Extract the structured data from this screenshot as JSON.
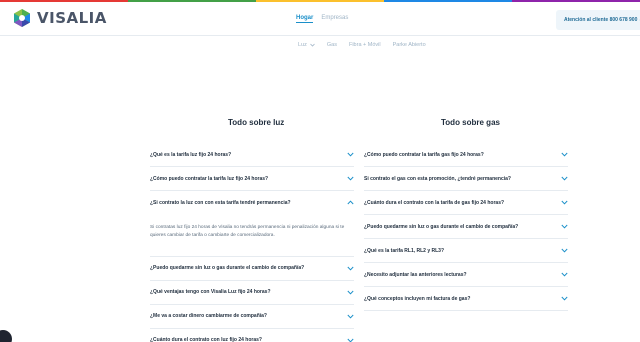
{
  "colors": {
    "brand_blue": "#1a8fc9",
    "text_dark": "#1f2d3d",
    "muted": "#9fb4c6",
    "divider": "#e6ebf0",
    "logo_grey": "#4a5568",
    "strip": [
      "#e53935",
      "#43a047",
      "#fbc02d",
      "#1e88e5",
      "#8e24aa"
    ]
  },
  "header": {
    "logo_text": "VISALIA",
    "logo_icon": "visalia-hexagon-logo",
    "nav": [
      {
        "label": "Hogar",
        "active": true
      },
      {
        "label": "Empresas",
        "active": false
      }
    ],
    "contact_label": "Atención al cliente 800 678 900",
    "contact_icon": "phone-icon"
  },
  "sub_nav": [
    {
      "label": "Luz",
      "has_dropdown": true
    },
    {
      "label": "Gas",
      "has_dropdown": false
    },
    {
      "label": "Fibra + Móvil",
      "has_dropdown": false
    },
    {
      "label": "Parke Abierto",
      "has_dropdown": false
    }
  ],
  "luz": {
    "title": "Todo sobre luz",
    "items": [
      {
        "question": "¿Qué es la tarifa luz fijo 24 horas?",
        "expanded": false
      },
      {
        "question": "¿Cómo puedo contratar la tarifa luz fijo 24 horas?",
        "expanded": false
      },
      {
        "question": "¿Si contrato la luz con con esta tarifa tendré permanencia?",
        "expanded": true,
        "answer": "Si contratas luz fijo 24 horas de Visalia no tendrás permanencia ni penalización alguna si te quieres cambiar de tarifa o cambiarte de comercializadora."
      },
      {
        "question": "¿Puedo quedarme sin luz o gas durante el cambio de compañía?",
        "expanded": false
      },
      {
        "question": "¿Qué ventajas tengo con Visalia Luz fijo 24 horas?",
        "expanded": false
      },
      {
        "question": "¿Me va a costar dinero cambiarme de compañía?",
        "expanded": false
      },
      {
        "question": "¿Cuánto dura el contrato con luz fijo 24 horas?",
        "expanded": false
      }
    ]
  },
  "gas": {
    "title": "Todo sobre gas",
    "items": [
      {
        "question": "¿Cómo puedo contratar la tarifa gas fijo 24 horas?",
        "expanded": false
      },
      {
        "question": "Si contrato el gas con esta promoción, ¿tendré permanencia?",
        "expanded": false
      },
      {
        "question": "¿Cuánto dura el contrato con la tarifa de gas fijo 24 horas?",
        "expanded": false
      },
      {
        "question": "¿Puedo quedarme sin luz o gas durante el cambio de compañía?",
        "expanded": false
      },
      {
        "question": "¿Qué es la tarifa RL1, RL2 y RL3?",
        "expanded": false
      },
      {
        "question": "¿Necesito adjuntar las anteriores lecturas?",
        "expanded": false
      },
      {
        "question": "¿Qué conceptos incluyen mi factura de gas?",
        "expanded": false
      }
    ]
  }
}
